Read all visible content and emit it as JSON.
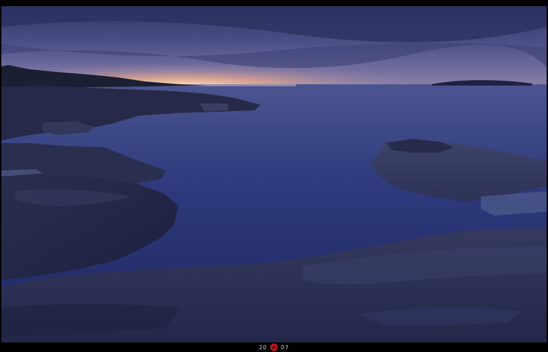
{
  "photo": {
    "subject": "dusk-seascape-rocky-shore"
  },
  "footer": {
    "year_left": "20",
    "year_right": "07",
    "logo_icon": "red-emblem-icon"
  },
  "colors": {
    "sky_top": "#3a3f72",
    "sunset_glow": "#f0c49a",
    "water": "#2a3470",
    "rock": "#2c3254",
    "logo_red": "#c8141e"
  }
}
